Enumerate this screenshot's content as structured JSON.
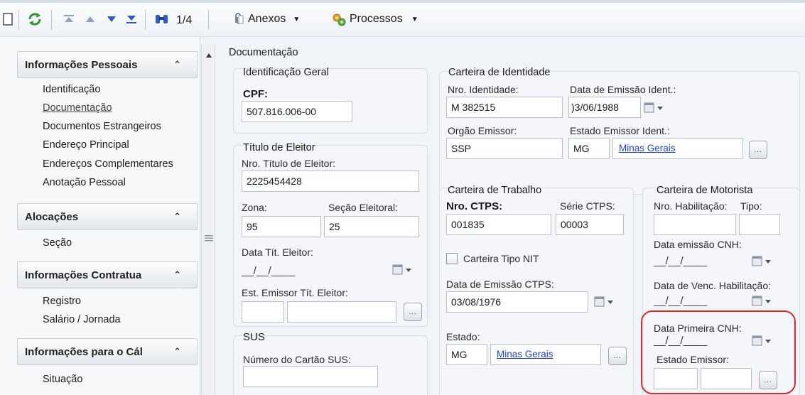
{
  "toolbar": {
    "page_indicator": "1/4",
    "attachments_label": "Anexos",
    "processes_label": "Processos"
  },
  "sidebar": {
    "sections": [
      {
        "title": "Informações Pessoais",
        "items": [
          "Identificação",
          "Documentação",
          "Documentos Estrangeiros",
          "Endereço Principal",
          "Endereços Complementares",
          "Anotação Pessoal"
        ]
      },
      {
        "title": "Alocações",
        "items": [
          "Seção"
        ]
      },
      {
        "title": "Informações Contratua",
        "items": [
          "Registro",
          "Salário / Jornada"
        ]
      },
      {
        "title": "Informações para o Cál",
        "items": [
          "Situação"
        ]
      }
    ],
    "active_item": "Documentação"
  },
  "documentacao": {
    "title": "Documentação",
    "identificacao_geral": {
      "title": "Identificação Geral",
      "cpf_label": "CPF:",
      "cpf_value": "507.816.006-00"
    },
    "titulo_eleitor": {
      "title": "Título de Eleitor",
      "numero_label": "Nro. Título de Eleitor:",
      "numero_value": "2225454428",
      "zona_label": "Zona:",
      "zona_value": "95",
      "secao_label": "Seção Eleitoral:",
      "secao_value": "25",
      "data_label": "Data Tít. Eleitor:",
      "data_value": "__/__/____",
      "estado_label": "Est. Emissor Tít. Eleitor:"
    },
    "sus": {
      "title": "SUS",
      "cartao_label": "Número do Cartão SUS:"
    },
    "carteira_identidade": {
      "title": "Carteira de Identidade",
      "numero_label": "Nro. Identidade:",
      "numero_value": "M 382515",
      "data_label": "Data de Emissão Ident.:",
      "data_value": ")3/06/1988",
      "orgao_label": "Orgão Emissor:",
      "orgao_value": "SSP",
      "estado_label": "Estado Emissor Ident.:",
      "estado_uf": "MG",
      "estado_nome": "Minas Gerais"
    },
    "carteira_trabalho": {
      "title": "Carteira de Trabalho",
      "ctps_label": "Nro. CTPS:",
      "ctps_value": "001835",
      "serie_label": "Série CTPS:",
      "serie_value": "00003",
      "tipo_nit_label": "Carteira Tipo NIT",
      "data_label": "Data de Emissão CTPS:",
      "data_value": "03/08/1976",
      "estado_label": "Estado:",
      "estado_uf": "MG",
      "estado_nome": "Minas Gerais"
    },
    "carteira_motorista": {
      "title": "Carteira de Motorista",
      "habilitacao_label": "Nro. Habilitação:",
      "tipo_label": "Tipo:",
      "emissao_label": "Data emissão CNH:",
      "emissao_value": "__/__/____",
      "vencimento_label": "Data de Venc. Habilitação:",
      "vencimento_value": "__/__/____",
      "primeira_label": "Data Primeira CNH:",
      "primeira_value": "__/__/____",
      "estado_label": "Estado Emissor:"
    }
  },
  "colors": {
    "highlight": "#e0282e",
    "link": "#1c3fd6"
  }
}
